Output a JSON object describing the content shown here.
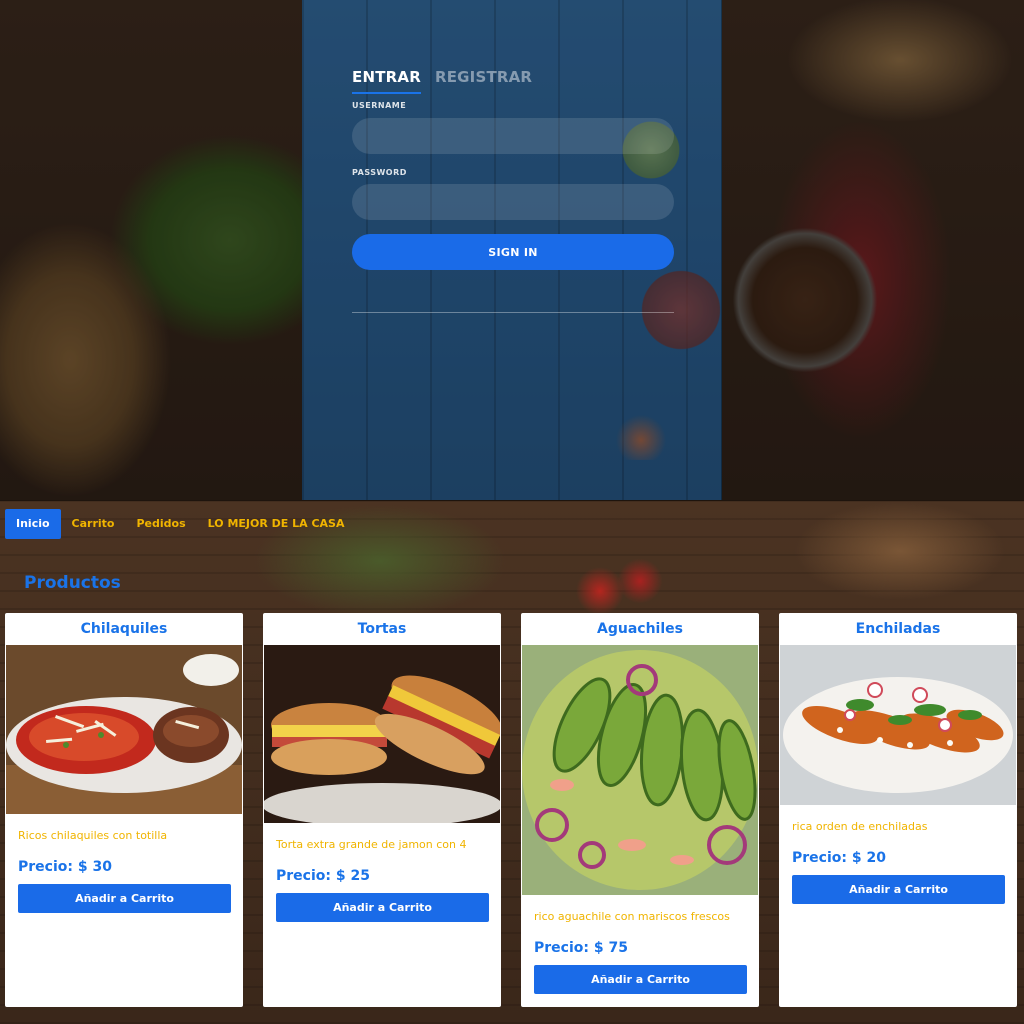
{
  "login": {
    "tabs": [
      {
        "label": "ENTRAR",
        "active": true
      },
      {
        "label": "REGISTRAR",
        "active": false
      }
    ],
    "username_label": "USERNAME",
    "username_value": "",
    "password_label": "PASSWORD",
    "password_value": "",
    "signin_label": "SIGN IN"
  },
  "nav": {
    "items": [
      {
        "label": "Inicio",
        "active": true
      },
      {
        "label": "Carrito",
        "active": false
      },
      {
        "label": "Pedidos",
        "active": false
      },
      {
        "label": "LO MEJOR DE LA CASA",
        "active": false
      }
    ]
  },
  "products": {
    "title": "Productos",
    "items": [
      {
        "name": "Chilaquiles",
        "description": "Ricos chilaquiles con totilla",
        "price": "Precio: $ 30",
        "button": "Añadir a Carrito"
      },
      {
        "name": "Tortas",
        "description": "Torta extra grande de jamon con 4",
        "price": "Precio: $ 25",
        "button": "Añadir a Carrito"
      },
      {
        "name": "Aguachiles",
        "description": "rico aguachile con mariscos frescos",
        "price": "Precio: $ 75",
        "button": "Añadir a Carrito"
      },
      {
        "name": "Enchiladas",
        "description": "rica orden de enchiladas",
        "price": "Precio: $ 20",
        "button": "Añadir a Carrito"
      }
    ]
  },
  "colors": {
    "accent": "#1a6be8",
    "title_blue": "#1a73e8",
    "yellow": "#f0b400"
  }
}
